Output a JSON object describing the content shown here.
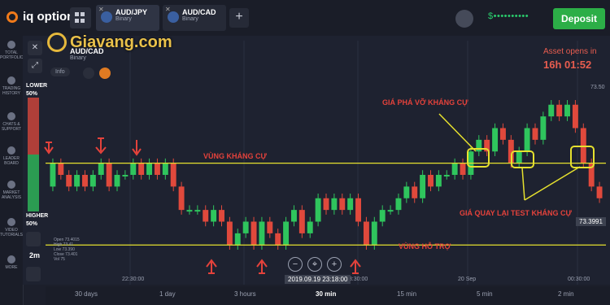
{
  "app": {
    "name": "iq option"
  },
  "tabs": [
    {
      "name": "AUD/JPY",
      "sub": "Binary"
    },
    {
      "name": "AUD/CAD",
      "sub": "Binary"
    }
  ],
  "header": {
    "balance": "$••••••••••",
    "deposit_label": "Deposit"
  },
  "watermark": "Giavang.com",
  "asset": {
    "name": "AUD/CAD",
    "type": "Binary",
    "info_label": "Info"
  },
  "sidebar": [
    "TOTAL PORTFOLIO",
    "TRADING HISTORY",
    "CHATS & SUPPORT",
    "LEADER BOARD",
    "MARKET ANALYSIS",
    "VIDEO TUTORIALS",
    "MORE"
  ],
  "left_panel": {
    "lower_label": "LOWER",
    "lower_pct": "50%",
    "higher_label": "HIGHER",
    "higher_pct": "50%",
    "timeframe": "2m"
  },
  "asset_opens": {
    "label": "Asset opens in",
    "time": "16h 01:52"
  },
  "annotations": {
    "breakout": "GIÁ PHÁ VỠ KHÁNG CỰ",
    "resistance": "VÙNG KHÁNG CỰ",
    "retest": "GIÁ QUAY LẠI TEST KHÁNG CỰ",
    "support": "VÙNG HỖ TRỢ"
  },
  "ohlc": {
    "open": "Open  73.4015",
    "high": "High  73.41",
    "low": "Low  73.390",
    "close": "Close  73.401",
    "vol": "Vol  75"
  },
  "price_tag": "73.3991",
  "y_axis_label": "73.50",
  "x_labels": [
    "22:30:00",
    "23:30:00",
    "20 Sep",
    "00:30:00"
  ],
  "date_tag": "2019.09.19 23:18:00",
  "timebar": [
    "30 days",
    "1 day",
    "3 hours",
    "30 min",
    "15 min",
    "5 min",
    "2 min"
  ],
  "timebar_active": "30 min",
  "colors": {
    "bull": "#2fc55d",
    "bear": "#e0493c",
    "level": "#e6e12e",
    "accent": "#2cae47"
  },
  "chart_data": {
    "type": "candlestick",
    "resistance_level": 73.44,
    "support_level": 73.37,
    "candles": [
      [
        73.42,
        73.44
      ],
      [
        73.44,
        73.43
      ],
      [
        73.43,
        73.42
      ],
      [
        73.42,
        73.43
      ],
      [
        73.43,
        73.42
      ],
      [
        73.42,
        73.43
      ],
      [
        73.43,
        73.44
      ],
      [
        73.44,
        73.42
      ],
      [
        73.42,
        73.43
      ],
      [
        73.43,
        73.43
      ],
      [
        73.43,
        73.44
      ],
      [
        73.44,
        73.43
      ],
      [
        73.43,
        73.44
      ],
      [
        73.44,
        73.43
      ],
      [
        73.43,
        73.44
      ],
      [
        73.44,
        73.42
      ],
      [
        73.42,
        73.4
      ],
      [
        73.4,
        73.4
      ],
      [
        73.4,
        73.4
      ],
      [
        73.4,
        73.39
      ],
      [
        73.39,
        73.4
      ],
      [
        73.4,
        73.39
      ],
      [
        73.39,
        73.37
      ],
      [
        73.37,
        73.38
      ],
      [
        73.38,
        73.39
      ],
      [
        73.39,
        73.37
      ],
      [
        73.37,
        73.39
      ],
      [
        73.39,
        73.38
      ],
      [
        73.38,
        73.37
      ],
      [
        73.37,
        73.39
      ],
      [
        73.39,
        73.4
      ],
      [
        73.4,
        73.38
      ],
      [
        73.38,
        73.39
      ],
      [
        73.39,
        73.41
      ],
      [
        73.41,
        73.4
      ],
      [
        73.4,
        73.41
      ],
      [
        73.41,
        73.4
      ],
      [
        73.4,
        73.41
      ],
      [
        73.41,
        73.39
      ],
      [
        73.39,
        73.37
      ],
      [
        73.37,
        73.39
      ],
      [
        73.39,
        73.4
      ],
      [
        73.4,
        73.4
      ],
      [
        73.4,
        73.41
      ],
      [
        73.41,
        73.42
      ],
      [
        73.42,
        73.41
      ],
      [
        73.41,
        73.43
      ],
      [
        73.43,
        73.42
      ],
      [
        73.42,
        73.43
      ],
      [
        73.43,
        73.43
      ],
      [
        73.43,
        73.44
      ],
      [
        73.44,
        73.43
      ],
      [
        73.43,
        73.45
      ],
      [
        73.45,
        73.46
      ],
      [
        73.46,
        73.45
      ],
      [
        73.45,
        73.47
      ],
      [
        73.47,
        73.46
      ],
      [
        73.46,
        73.44
      ],
      [
        73.44,
        73.45
      ],
      [
        73.45,
        73.47
      ],
      [
        73.47,
        73.46
      ],
      [
        73.46,
        73.48
      ],
      [
        73.48,
        73.49
      ],
      [
        73.49,
        73.48
      ],
      [
        73.48,
        73.49
      ],
      [
        73.49,
        73.47
      ],
      [
        73.47,
        73.44
      ],
      [
        73.44,
        73.42
      ],
      [
        73.42,
        73.41
      ]
    ]
  }
}
